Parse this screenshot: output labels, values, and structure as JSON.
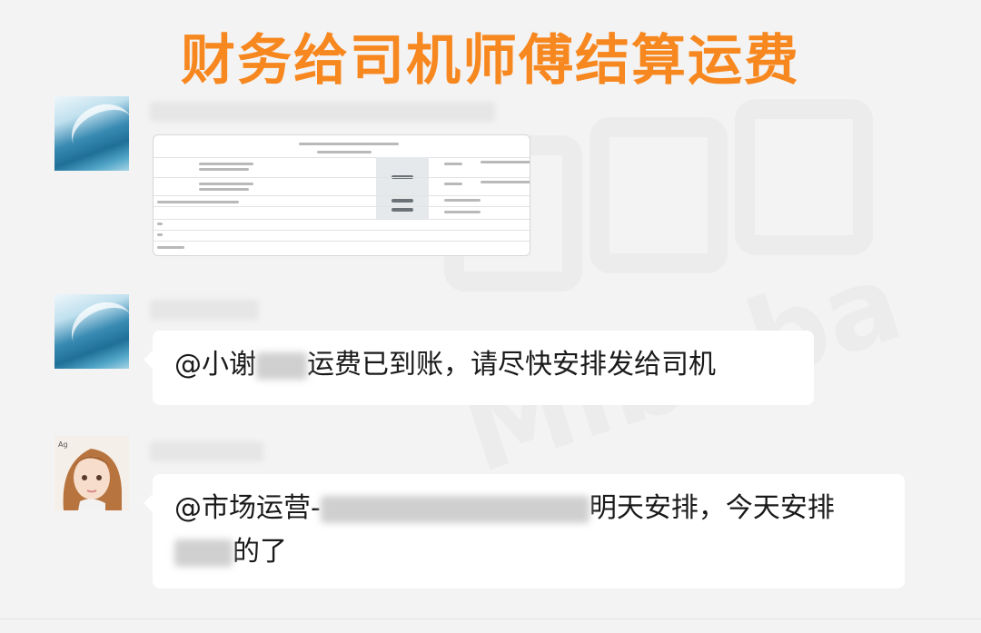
{
  "title": "财务给司机师傅结算运费",
  "watermark": {
    "chars": "密巴巴",
    "latin": "Mibaba"
  },
  "messages": [
    {
      "kind": "document"
    },
    {
      "kind": "text",
      "prefix": "@小谢",
      "suffix": "运费已到账，请尽快安排发给司机"
    },
    {
      "kind": "text",
      "prefix": "@市场运营-",
      "mid": "明天安排，今天安排",
      "end": "的了"
    }
  ],
  "colors": {
    "title": "#f7871f",
    "background": "#f3f3f3",
    "bubble": "#ffffff"
  }
}
